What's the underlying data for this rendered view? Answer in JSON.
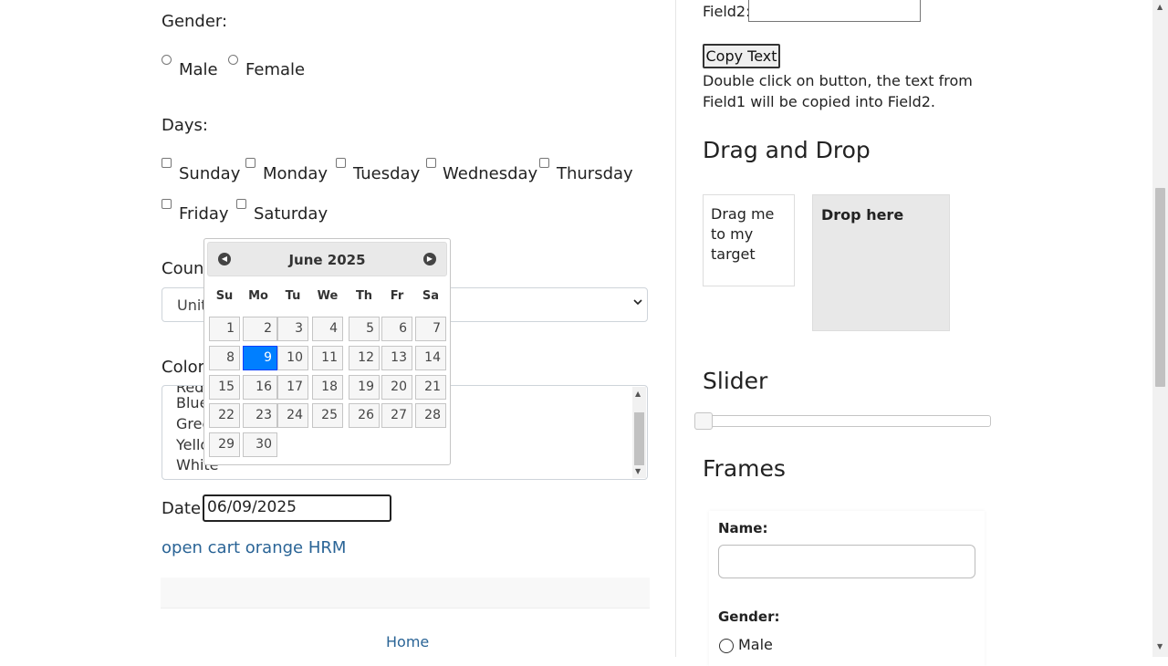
{
  "left": {
    "gender": {
      "label": "Gender:",
      "options": [
        "Male",
        "Female"
      ]
    },
    "days": {
      "label": "Days:",
      "options": [
        "Sunday",
        "Monday",
        "Tuesday",
        "Wednesday",
        "Thursday",
        "Friday",
        "Saturday"
      ]
    },
    "country": {
      "label": "Count",
      "selected": "Unit"
    },
    "colors": {
      "label": "Colors",
      "options": [
        "Red",
        "Blue",
        "Gree",
        "Yello",
        "White"
      ]
    },
    "date": {
      "label": "Date:",
      "value": "06/09/2025"
    },
    "link": "open cart orange HRM",
    "footer_link": "Home"
  },
  "datepicker": {
    "month_year": "June 2025",
    "prev_icon": "chevron-left-icon",
    "next_icon": "chevron-right-icon",
    "weekdays": [
      "Su",
      "Mo",
      "Tu",
      "We",
      "Th",
      "Fr",
      "Sa"
    ],
    "days": [
      "1",
      "2",
      "3",
      "4",
      "5",
      "6",
      "7",
      "8",
      "9",
      "10",
      "11",
      "12",
      "13",
      "14",
      "15",
      "16",
      "17",
      "18",
      "19",
      "20",
      "21",
      "22",
      "23",
      "24",
      "25",
      "26",
      "27",
      "28",
      "29",
      "30"
    ],
    "selected_day": "9",
    "selected_color": "#007fff"
  },
  "right": {
    "field2_label": "Field2:",
    "copy_button": "Copy Text",
    "copy_help": "Double click on button, the text from Field1 will be copied into Field2.",
    "drag_title": "Drag and Drop",
    "drag_text": "Drag me to my target",
    "drop_text": "Drop here",
    "slider_title": "Slider",
    "slider_value": 0,
    "frames_title": "Frames",
    "frame": {
      "name_label": "Name:",
      "gender_label": "Gender:",
      "male_label": "Male"
    }
  },
  "colors": {
    "link": "#2a6496",
    "selected_day": "#007fff"
  }
}
